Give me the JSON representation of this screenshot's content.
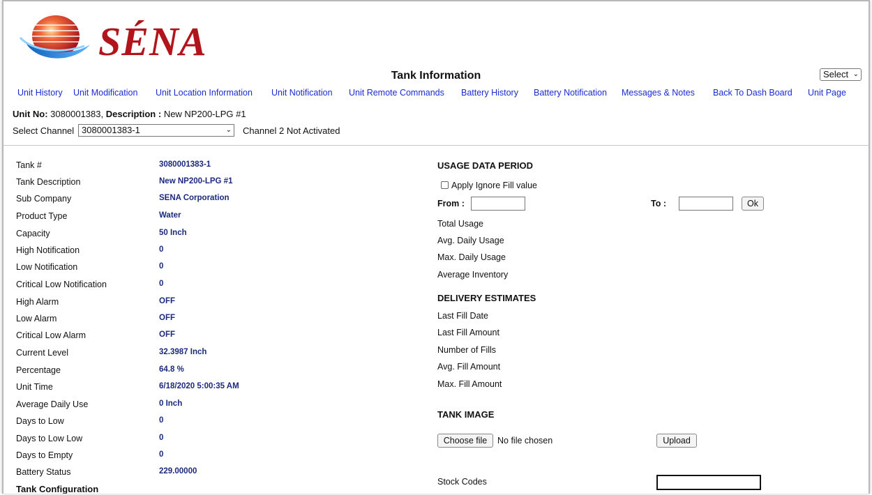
{
  "brand": {
    "name": "SÉNA"
  },
  "page": {
    "title": "Tank Information"
  },
  "select_dropdown": {
    "value": "Select"
  },
  "nav": [
    "Unit History",
    "Unit Modification",
    "Unit Location Information",
    "Unit Notification",
    "Unit Remote Commands",
    "Battery History",
    "Battery Notification",
    "Messages & Notes",
    "Back To Dash Board",
    "Unit Page"
  ],
  "unit": {
    "no_label": "Unit No:",
    "no_value": "3080001383",
    "desc_label": "Description :",
    "desc_value": "New NP200-LPG #1"
  },
  "channel": {
    "label": "Select Channel",
    "value": "3080001383-1",
    "note": "Channel 2 Not Activated"
  },
  "details": [
    {
      "label": "Tank #",
      "value": "3080001383-1"
    },
    {
      "label": "Tank Description",
      "value": "New NP200-LPG #1"
    },
    {
      "label": "Sub Company",
      "value": "SENA Corporation"
    },
    {
      "label": "Product Type",
      "value": "Water"
    },
    {
      "label": "Capacity",
      "value": "50 Inch"
    },
    {
      "label": "High Notification",
      "value": "0"
    },
    {
      "label": "Low Notification",
      "value": "0"
    },
    {
      "label": "Critical Low Notification",
      "value": "0"
    },
    {
      "label": "High Alarm",
      "value": "OFF"
    },
    {
      "label": "Low Alarm",
      "value": "OFF"
    },
    {
      "label": "Critical Low Alarm",
      "value": "OFF"
    },
    {
      "label": "Current Level",
      "value": "32.3987 Inch"
    },
    {
      "label": "Percentage",
      "value": "64.8 %"
    },
    {
      "label": "Unit Time",
      "value": "6/18/2020 5:00:35 AM"
    },
    {
      "label": "Average Daily Use",
      "value": "0 Inch"
    },
    {
      "label": "Days to Low",
      "value": "0"
    },
    {
      "label": "Days to Low Low",
      "value": "0"
    },
    {
      "label": "Days to Empty",
      "value": "0"
    },
    {
      "label": "Battery Status",
      "value": "229.00000"
    }
  ],
  "tank_configuration": "Tank Configuration",
  "usage": {
    "heading": "USAGE DATA PERIOD",
    "ignore_fill": "Apply Ignore Fill value",
    "from_label": "From :",
    "from_value": "",
    "to_label": "To :",
    "to_value": "",
    "ok_label": "Ok",
    "metrics": [
      "Total Usage",
      "Avg. Daily Usage",
      "Max. Daily Usage",
      "Average Inventory"
    ]
  },
  "delivery": {
    "heading": "DELIVERY ESTIMATES",
    "metrics": [
      "Last Fill Date",
      "Last Fill Amount",
      "Number of Fills",
      "Avg. Fill Amount",
      "Max. Fill Amount"
    ]
  },
  "tank_image": {
    "heading": "TANK IMAGE",
    "choose_label": "Choose file",
    "file_status": "No file chosen",
    "upload_label": "Upload"
  },
  "stock_codes": {
    "label": "Stock Codes",
    "value": ""
  },
  "colors": {
    "link": "#1a2bd1",
    "value": "#1b2a7c",
    "brand": "#b1141a"
  }
}
